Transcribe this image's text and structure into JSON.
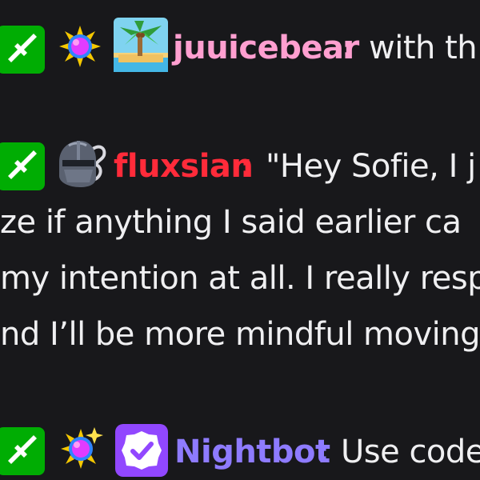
{
  "colors": {
    "background": "#18181b",
    "text": "#efeff1",
    "moderator_badge": "#00ad03",
    "juuicebear_name": "#ff9fd0",
    "fluxsian_name": "#ff2b3a",
    "nightbot_name": "#8e7bff",
    "verified_badge": "#9147ff"
  },
  "messages": [
    {
      "badges": [
        "moderator-sword-icon",
        "sun-emblem-icon",
        "palm-island-icon"
      ],
      "username": "juuicebear",
      "separator": ":",
      "text": "with th"
    },
    {
      "badges": [
        "moderator-sword-icon",
        "knight-helmet-icon"
      ],
      "username": "fluxsian",
      "separator": ":",
      "text_lines": [
        "\"Hey Sofie, I j",
        "ze if anything I said earlier ca",
        "my intention at all. I really resp",
        "nd I’ll be more mindful moving"
      ]
    },
    {
      "badges": [
        "moderator-sword-icon",
        "sparkle-sun-emblem-icon",
        "verified-check-icon"
      ],
      "username": "Nightbot",
      "separator": ":",
      "text": "Use code"
    }
  ]
}
